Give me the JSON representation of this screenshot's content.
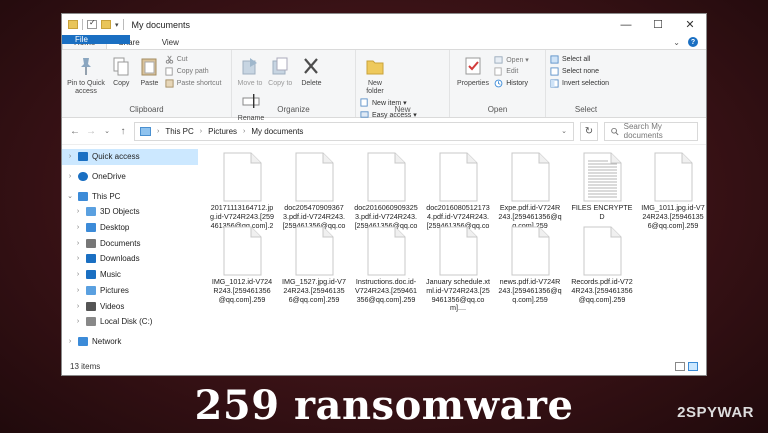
{
  "window": {
    "title": "My documents",
    "controls": {
      "minimize": "—",
      "maximize": "☐",
      "close": "✕"
    }
  },
  "ribbon_tabs": [
    "File",
    "Home",
    "Share",
    "View"
  ],
  "ribbon": {
    "clipboard": {
      "label": "Clipboard",
      "pin": "Pin to Quick access",
      "copy": "Copy",
      "paste": "Paste",
      "cut": "Cut",
      "copy_path": "Copy path",
      "paste_shortcut": "Paste shortcut"
    },
    "organize": {
      "label": "Organize",
      "move_to": "Move to",
      "copy_to": "Copy to",
      "delete": "Delete",
      "rename": "Rename"
    },
    "new": {
      "label": "New",
      "new_folder": "New folder",
      "new_item": "New item ▾",
      "easy_access": "Easy access ▾"
    },
    "open": {
      "label": "Open",
      "properties": "Properties",
      "open": "Open ▾",
      "edit": "Edit",
      "history": "History"
    },
    "select": {
      "label": "Select",
      "select_all": "Select all",
      "select_none": "Select none",
      "invert": "Invert selection"
    }
  },
  "address": {
    "crumbs": [
      "This PC",
      "Pictures",
      "My documents"
    ],
    "search_placeholder": "Search My documents"
  },
  "sidebar": [
    {
      "label": "Quick access",
      "selected": true,
      "icon": "star-icon",
      "color": "#1a6fc2"
    },
    {
      "label": "OneDrive",
      "icon": "cloud-icon",
      "color": "#1a6fc2"
    },
    {
      "label": "This PC",
      "icon": "computer-icon",
      "color": "#3c8bd8"
    },
    {
      "label": "3D Objects",
      "icon": "cube-icon",
      "color": "#5aa0e0"
    },
    {
      "label": "Desktop",
      "icon": "desktop-icon",
      "color": "#3c8bd8"
    },
    {
      "label": "Documents",
      "icon": "documents-icon",
      "color": "#777777"
    },
    {
      "label": "Downloads",
      "icon": "download-icon",
      "color": "#1a6fc2"
    },
    {
      "label": "Music",
      "icon": "music-icon",
      "color": "#1a6fc2"
    },
    {
      "label": "Pictures",
      "icon": "pictures-icon",
      "color": "#5aa0e0"
    },
    {
      "label": "Videos",
      "icon": "videos-icon",
      "color": "#555555"
    },
    {
      "label": "Local Disk (C:)",
      "icon": "disk-icon",
      "color": "#888888"
    },
    {
      "label": "Network",
      "icon": "network-icon",
      "color": "#3c8bd8"
    }
  ],
  "files": [
    {
      "name": "20171113164712.jpg.id-V724R243.[259461356@qq.com].259",
      "kind": "blank"
    },
    {
      "name": "doc2054709093673.pdf.id-V724R243.[259461356@qq.com].259",
      "kind": "blank"
    },
    {
      "name": "doc2016060909325 3.pdf.id-V724R243.[259461356@qq.com].259",
      "kind": "blank"
    },
    {
      "name": "doc2016080512173 4.pdf.id-V724R243.[259461356@qq.com].259",
      "kind": "blank"
    },
    {
      "name": "Expe.pdf.id-V724R243.[259461356@qq.com].259",
      "kind": "blank"
    },
    {
      "name": "FILES ENCRYPTED",
      "kind": "text"
    },
    {
      "name": "IMG_1011.jpg.id-V724R243.[259461356@qq.com].259",
      "kind": "blank"
    },
    {
      "name": "IMG_1012.id-V724R243.[259461356@qq.com].259",
      "kind": "blank"
    },
    {
      "name": "IMG_1527.jpg.id-V724R243.[259461356@qq.com].259",
      "kind": "blank"
    },
    {
      "name": "Instructions.doc.id-V724R243.[259461356@qq.com].259",
      "kind": "blank"
    },
    {
      "name": "January schedule.xtml.id-V724R243.[259461356@qq.com]....",
      "kind": "blank"
    },
    {
      "name": "news.pdf.id-V724R243.[259461356@qq.com].259",
      "kind": "blank"
    },
    {
      "name": "Records.pdf.id-V724R243.[259461356@qq.com].259",
      "kind": "blank"
    }
  ],
  "status": {
    "count": "13 items"
  },
  "caption": "259 ransomware",
  "watermark": "2SPYWAR"
}
